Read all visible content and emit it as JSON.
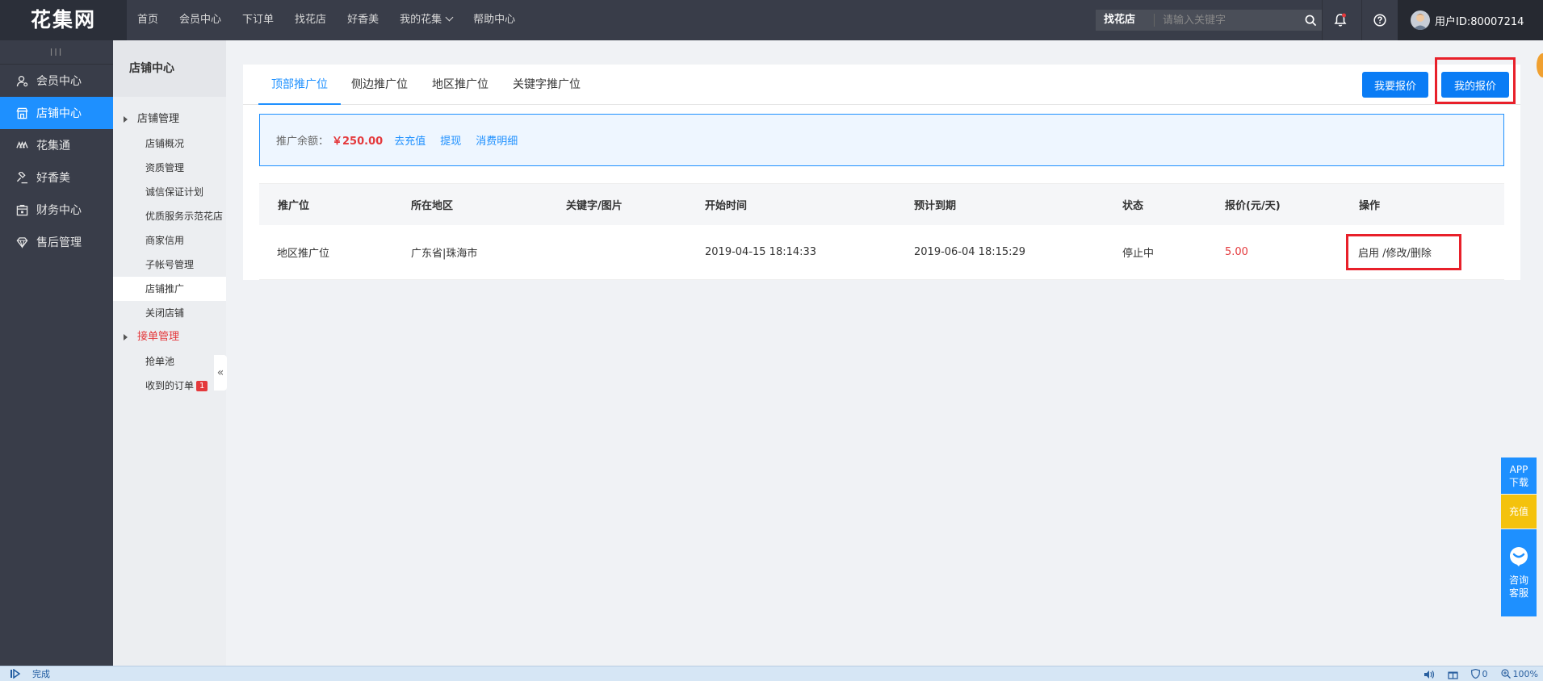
{
  "header": {
    "logo": "花集网",
    "nav": [
      "首页",
      "会员中心",
      "下订单",
      "找花店",
      "好香美",
      "我的花集",
      "帮助中心"
    ],
    "search_scope": "找花店",
    "search_placeholder": "请输入关键字",
    "user_label": "用户ID:80007214",
    "icons": [
      "search-icon",
      "bell-icon",
      "help-icon",
      "chevron-down-icon"
    ]
  },
  "sidebar": {
    "collapse_label": "III",
    "items": [
      {
        "label": "会员中心",
        "icon": "user-icon"
      },
      {
        "label": "店铺中心",
        "icon": "store-icon",
        "active": true
      },
      {
        "label": "花集通",
        "icon": "link-icon"
      },
      {
        "label": "好香美",
        "icon": "gavel-icon"
      },
      {
        "label": "财务中心",
        "icon": "finance-icon"
      },
      {
        "label": "售后管理",
        "icon": "diamond-icon"
      }
    ]
  },
  "subsidebar": {
    "title": "店铺中心",
    "group1": "店铺管理",
    "group1_items": [
      "店铺概况",
      "资质管理",
      "诚信保证计划",
      "优质服务示范花店",
      "商家信用",
      "子帐号管理",
      "店铺推广",
      "关闭店铺"
    ],
    "group2": "接单管理",
    "group2_items": [
      "抢单池",
      "收到的订单"
    ],
    "order_badge": "1",
    "collapse_glyph": "«"
  },
  "tabs": [
    "顶部推广位",
    "侧边推广位",
    "地区推广位",
    "关键字推广位"
  ],
  "actions": {
    "bid": "我要报价",
    "my_bids": "我的报价"
  },
  "balance": {
    "label": "推广余额：",
    "amount": "￥250.00",
    "links": [
      "去充值",
      "提现",
      "消费明细"
    ]
  },
  "table": {
    "columns": [
      "推广位",
      "所在地区",
      "关键字/图片",
      "开始时间",
      "预计到期",
      "状态",
      "报价(元/天)",
      "操作"
    ],
    "rows": [
      {
        "slot": "地区推广位",
        "region": "广东省|珠海市",
        "keyword": "",
        "start": "2019-04-15 18:14:33",
        "end": "2019-06-04 18:15:29",
        "status": "停止中",
        "price": "5.00",
        "ops": "启用 /修改/删除"
      }
    ]
  },
  "float": {
    "app": [
      "APP",
      "下载"
    ],
    "charge": "充值",
    "service": [
      "咨询",
      "客服"
    ]
  },
  "statusbar": {
    "text": "完成",
    "shield_count": "0",
    "zoom": "100%"
  },
  "colors": {
    "topbar": "#393d49",
    "accent": "#1e90ff",
    "highlight_box": "#e8202a",
    "price": "#e4393c"
  }
}
